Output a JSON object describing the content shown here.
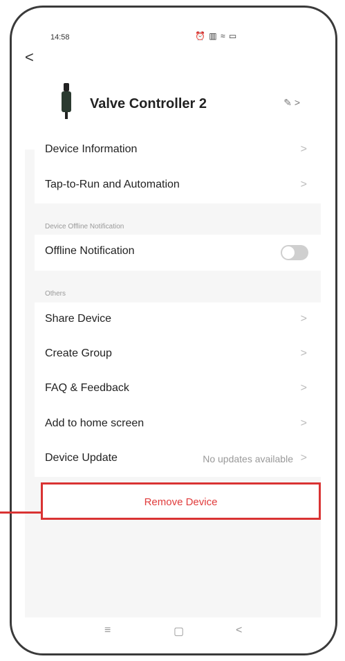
{
  "status": {
    "time": "14:58",
    "icons": "⏰ ▥ ≈ ▭"
  },
  "header": {
    "back_label": "<",
    "device_name": "Valve Controller 2",
    "edit_label": "✎ >"
  },
  "rows_main": [
    {
      "label": "Device Information",
      "chev": ">"
    },
    {
      "label": "Tap-to-Run and Automation",
      "chev": ">"
    }
  ],
  "offline_section": {
    "header": "Device Offline Notification",
    "row_label": "Offline Notification"
  },
  "others_section": {
    "header": "Others",
    "rows": [
      {
        "label": "Share Device",
        "chev": ">"
      },
      {
        "label": "Create Group",
        "chev": ">"
      },
      {
        "label": "FAQ & Feedback",
        "chev": ">"
      },
      {
        "label": "Add to home screen",
        "chev": ">"
      },
      {
        "label": "Device Update",
        "value": "No updates available",
        "chev": ">"
      }
    ]
  },
  "remove": {
    "label": "Remove Device"
  },
  "navbar": {
    "menu": "≡",
    "home": "▢",
    "back": "<"
  },
  "colors": {
    "accent_red": "#e03b3b",
    "callout_red": "#d93333"
  }
}
